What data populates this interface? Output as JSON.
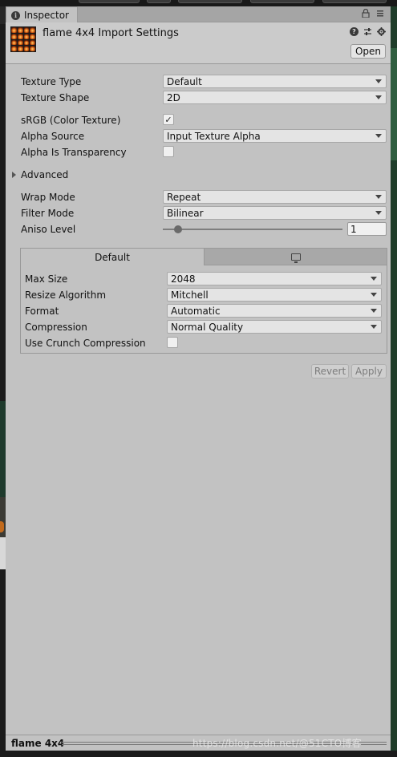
{
  "window": {
    "tab_label": "Inspector",
    "tab_icon": "info-icon"
  },
  "header": {
    "title": "flame 4x4 Import Settings",
    "open_label": "Open",
    "help_icon": "question-mark-icon",
    "presets_icon": "sliders-icon",
    "settings_icon": "gear-icon"
  },
  "settings": {
    "texture_type_label": "Texture Type",
    "texture_type_value": "Default",
    "texture_shape_label": "Texture Shape",
    "texture_shape_value": "2D",
    "srgb_label": "sRGB (Color Texture)",
    "srgb_checked": true,
    "alpha_source_label": "Alpha Source",
    "alpha_source_value": "Input Texture Alpha",
    "alpha_transparency_label": "Alpha Is Transparency",
    "alpha_transparency_checked": false,
    "advanced_label": "Advanced",
    "wrap_mode_label": "Wrap Mode",
    "wrap_mode_value": "Repeat",
    "filter_mode_label": "Filter Mode",
    "filter_mode_value": "Bilinear",
    "aniso_label": "Aniso Level",
    "aniso_value": "1",
    "aniso_slider_fraction": 0.0625
  },
  "platform": {
    "default_tab_label": "Default",
    "pc_tab_icon": "monitor-icon",
    "max_size_label": "Max Size",
    "max_size_value": "2048",
    "resize_label": "Resize Algorithm",
    "resize_value": "Mitchell",
    "format_label": "Format",
    "format_value": "Automatic",
    "compression_label": "Compression",
    "compression_value": "Normal Quality",
    "crunch_label": "Use Crunch Compression",
    "crunch_checked": false
  },
  "actions": {
    "revert_label": "Revert",
    "apply_label": "Apply"
  },
  "status": {
    "asset_name": "flame 4x4",
    "watermark": "https://blog.csdn.net/@51CTO博客"
  }
}
